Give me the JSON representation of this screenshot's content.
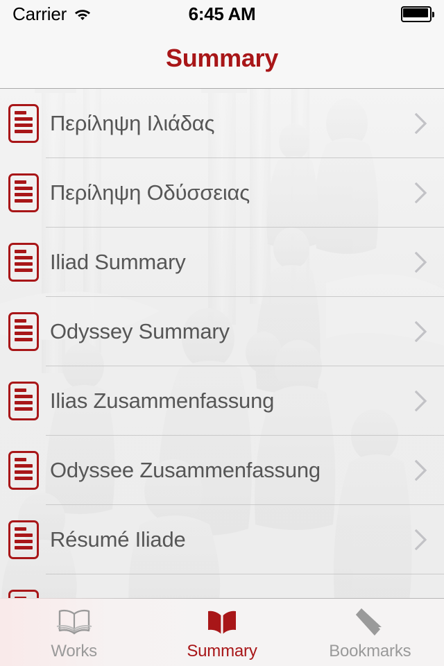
{
  "status_bar": {
    "carrier": "Carrier",
    "wifi_icon": "wifi-icon",
    "time": "6:45 AM",
    "battery_icon": "battery-full-icon"
  },
  "nav": {
    "title": "Summary",
    "title_color": "#A81618"
  },
  "list": {
    "accent_color": "#A81618",
    "label_color": "#565656",
    "items": [
      {
        "label": "Περίληψη Ιλιάδας",
        "icon": "document-icon",
        "chevron": "chevron-right-icon"
      },
      {
        "label": "Περίληψη Οδύσσειας",
        "icon": "document-icon",
        "chevron": "chevron-right-icon"
      },
      {
        "label": "Iliad Summary",
        "icon": "document-icon",
        "chevron": "chevron-right-icon"
      },
      {
        "label": "Odyssey Summary",
        "icon": "document-icon",
        "chevron": "chevron-right-icon"
      },
      {
        "label": "Ilias Zusammenfassung",
        "icon": "document-icon",
        "chevron": "chevron-right-icon"
      },
      {
        "label": "Odyssee Zusammenfassung",
        "icon": "document-icon",
        "chevron": "chevron-right-icon"
      },
      {
        "label": "Résumé Iliade",
        "icon": "document-icon",
        "chevron": "chevron-right-icon"
      },
      {
        "label": "",
        "icon": "document-icon",
        "chevron": "chevron-right-icon"
      }
    ]
  },
  "tabbar": {
    "active_index": 1,
    "active_color": "#A81618",
    "inactive_color": "#9a9a9a",
    "tabs": [
      {
        "label": "Works",
        "icon": "open-book-icon"
      },
      {
        "label": "Summary",
        "icon": "book-filled-icon"
      },
      {
        "label": "Bookmarks",
        "icon": "bookmark-icon"
      }
    ]
  }
}
